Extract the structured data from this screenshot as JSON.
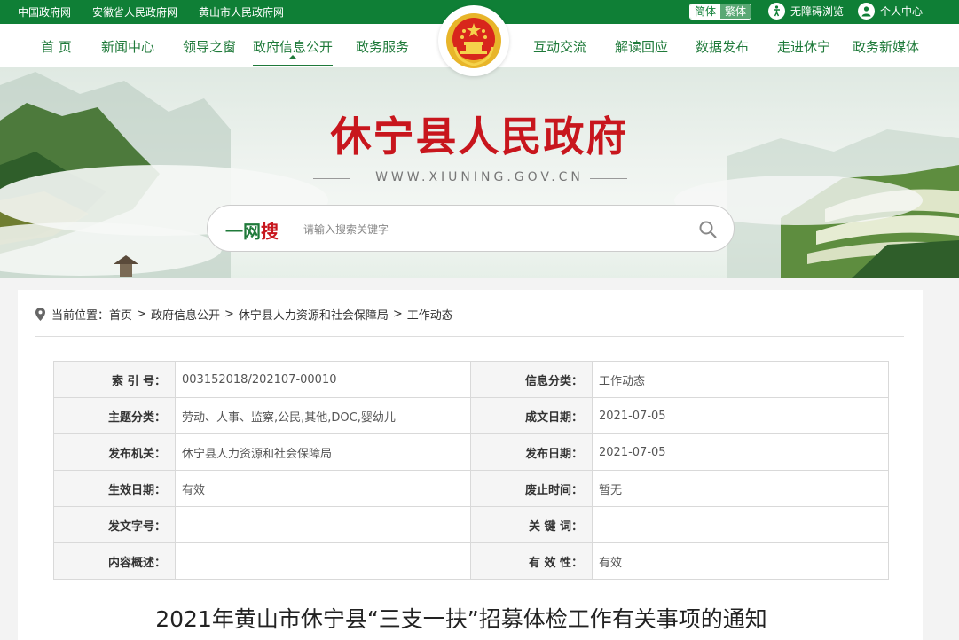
{
  "topbar": {
    "links": [
      "中国政府网",
      "安徽省人民政府网",
      "黄山市人民政府网"
    ],
    "lang_simplified": "简体",
    "lang_traditional": "繁体",
    "accessibility": "无障碍浏览",
    "user_center": "个人中心"
  },
  "nav": {
    "left": [
      "首 页",
      "新闻中心",
      "领导之窗",
      "政府信息公开",
      "政务服务"
    ],
    "right": [
      "互动交流",
      "解读回应",
      "数据发布",
      "走进休宁",
      "政务新媒体"
    ],
    "active": "政府信息公开"
  },
  "banner": {
    "title": "休宁县人民政府",
    "domain": "WWW.XIUNING.GOV.CN"
  },
  "search": {
    "brand_a": "一网",
    "brand_b": "搜",
    "placeholder": "请输入搜索关键字"
  },
  "breadcrumb": {
    "prefix": "当前位置：",
    "items": [
      "首页",
      "政府信息公开",
      "休宁县人力资源和社会保障局",
      "工作动态"
    ]
  },
  "meta": {
    "rows": [
      {
        "k1": "索 引 号：",
        "v1": "003152018/202107-00010",
        "k2": "信息分类：",
        "v2": "工作动态"
      },
      {
        "k1": "主题分类：",
        "v1": "劳动、人事、监察,公民,其他,DOC,婴幼儿",
        "k2": "成文日期：",
        "v2": "2021-07-05"
      },
      {
        "k1": "发布机关：",
        "v1": "休宁县人力资源和社会保障局",
        "k2": "发布日期：",
        "v2": "2021-07-05"
      },
      {
        "k1": "生效日期：",
        "v1": "有效",
        "k2": "废止时间：",
        "v2": "暂无"
      },
      {
        "k1": "发文字号：",
        "v1": "",
        "k2": "关 键 词：",
        "v2": ""
      },
      {
        "k1": "内容概述：",
        "v1": "",
        "k2": "有 效 性：",
        "v2": "有效"
      }
    ]
  },
  "document": {
    "title": "2021年黄山市休宁县“三支一扶”招募体检工作有关事项的通知"
  },
  "colors": {
    "brand_green": "#0f7f36",
    "title_red": "#c8161d"
  }
}
